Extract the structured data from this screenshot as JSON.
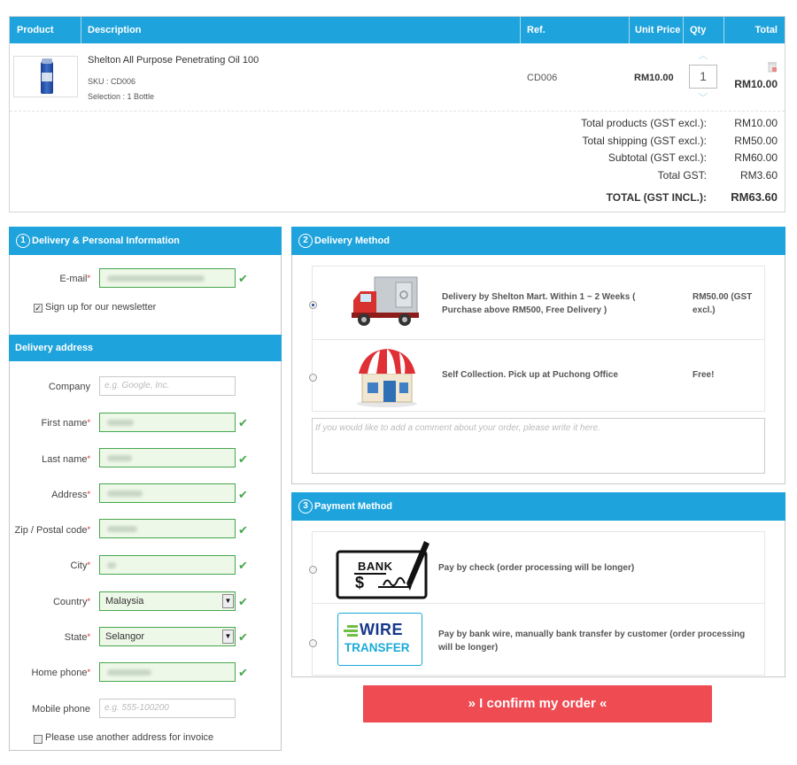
{
  "cart": {
    "headers": {
      "product": "Product",
      "description": "Description",
      "ref": "Ref.",
      "unit_price": "Unit Price",
      "qty": "Qty",
      "total": "Total"
    },
    "item": {
      "name": "Shelton All Purpose Penetrating Oil 100",
      "sku": "SKU : CD006",
      "selection": "Selection : 1 Bottle",
      "ref": "CD006",
      "unit_price": "RM10.00",
      "qty": "1",
      "total": "RM10.00"
    },
    "summary": [
      {
        "label": "Total products (GST excl.):",
        "value": "RM10.00"
      },
      {
        "label": "Total shipping (GST excl.):",
        "value": "RM50.00"
      },
      {
        "label": "Subtotal (GST excl.):",
        "value": "RM60.00"
      },
      {
        "label": "Total GST:",
        "value": "RM3.60"
      },
      {
        "label": "TOTAL (GST INCL.):",
        "value": "RM63.60"
      }
    ]
  },
  "delivery_info": {
    "step": "1",
    "title": "Delivery & Personal Information",
    "email_label": "E-mail",
    "newsletter_label": "Sign up for our newsletter",
    "address_title": "Delivery address",
    "fields": {
      "company_label": "Company",
      "company_placeholder": "e.g. Google, Inc.",
      "first_name_label": "First name",
      "last_name_label": "Last name",
      "address_label": "Address",
      "zip_label": "Zip / Postal code",
      "city_label": "City",
      "country_label": "Country",
      "country_value": "Malaysia",
      "state_label": "State",
      "state_value": "Selangor",
      "home_phone_label": "Home phone",
      "mobile_phone_label": "Mobile phone",
      "mobile_phone_placeholder": "e.g. 555-100200"
    },
    "invoice_label": "Please use another address for invoice"
  },
  "delivery_method": {
    "step": "2",
    "title": "Delivery Method",
    "options": [
      {
        "text": "Delivery by Shelton Mart. Within 1 ~ 2 Weeks ( Purchase above RM500, Free Delivery )",
        "price": "RM50.00 (GST excl.)",
        "icon": "delivery-truck-icon"
      },
      {
        "text": "Self Collection. Pick up at Puchong Office",
        "price": "Free!",
        "icon": "store-icon"
      }
    ],
    "comment_placeholder": "If you would like to add a comment about your order, please write it here."
  },
  "payment_method": {
    "step": "3",
    "title": "Payment Method",
    "options": [
      {
        "text": "Pay by check (order processing will be longer)",
        "icon": "bank-check-icon",
        "logo_text": "BANK",
        "logo_symbol": "$"
      },
      {
        "text": "Pay by bank wire, manually bank transfer by customer (order processing will be longer)",
        "icon": "wire-transfer-icon",
        "logo_text": "WIRE",
        "logo_text2": "TRANSFER"
      }
    ]
  },
  "confirm_button": "»  I confirm my order  «",
  "colors": {
    "accent": "#1ea3dc",
    "confirm": "#ef4b52",
    "valid": "#46a74e"
  }
}
